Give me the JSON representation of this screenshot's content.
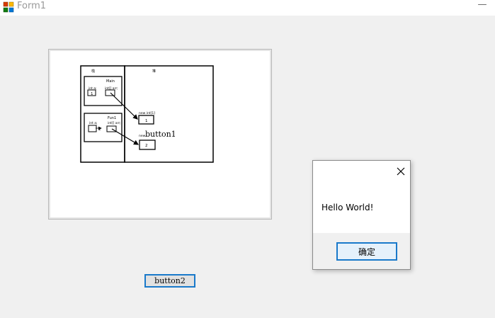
{
  "window": {
    "title": "Form1",
    "minimize_glyph": "—"
  },
  "picture": {
    "stack_label": "栈",
    "heap_label": "堆",
    "main_label": "Main",
    "main_int_a": "int a;",
    "main_int_arr": "int[] arr;",
    "main_a_value": "1",
    "fun_label": "Fun1",
    "fun_int_a": "int a;",
    "fun_int_arr": "int[] arr;",
    "fun_a_value": "2",
    "heap_new_1": "new int[1]",
    "heap_value_1": "1",
    "heap_new_2": "new",
    "heap_value_2": "2"
  },
  "button1": {
    "label": "button1"
  },
  "button2": {
    "label": "button2"
  },
  "messagebox": {
    "text": "Hello World!",
    "ok_label": "确定"
  },
  "colors": {
    "accent": "#1979ca",
    "window_bg": "#f0f0f0"
  }
}
